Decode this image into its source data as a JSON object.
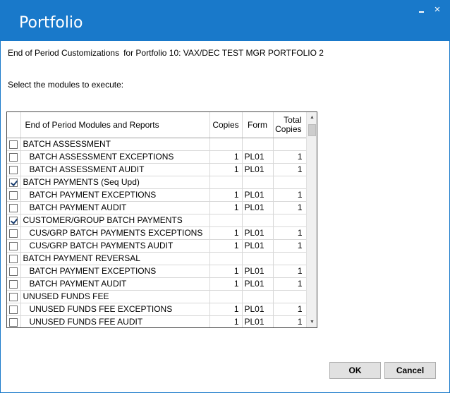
{
  "window": {
    "title": "Portfolio",
    "minimize_icon": "minimize-icon",
    "close_glyph": "×",
    "close_icon": "close-icon"
  },
  "header": {
    "heading": "End of Period Customizations",
    "portfolio_text": "for Portfolio 10: VAX/DEC TEST MGR PORTFOLIO 2",
    "prompt": "Select the modules to execute:"
  },
  "grid": {
    "columns": {
      "name": "End of Period Modules and Reports",
      "copies": "Copies",
      "form": "Form",
      "total_line1": "Total",
      "total_line2": "Copies"
    },
    "rows": [
      {
        "checked": false,
        "child": false,
        "name": "BATCH ASSESSMENT",
        "copies": "",
        "form": "",
        "total": ""
      },
      {
        "checked": false,
        "child": true,
        "name": "BATCH ASSESSMENT EXCEPTIONS",
        "copies": "1",
        "form": "PL01",
        "total": "1"
      },
      {
        "checked": false,
        "child": true,
        "name": "BATCH ASSESSMENT AUDIT",
        "copies": "1",
        "form": "PL01",
        "total": "1"
      },
      {
        "checked": true,
        "child": false,
        "name": "BATCH PAYMENTS (Seq Upd)",
        "copies": "",
        "form": "",
        "total": ""
      },
      {
        "checked": false,
        "child": true,
        "name": "BATCH PAYMENT EXCEPTIONS",
        "copies": "1",
        "form": "PL01",
        "total": "1"
      },
      {
        "checked": false,
        "child": true,
        "name": "BATCH PAYMENT AUDIT",
        "copies": "1",
        "form": "PL01",
        "total": "1"
      },
      {
        "checked": true,
        "child": false,
        "name": "CUSTOMER/GROUP BATCH PAYMENTS",
        "copies": "",
        "form": "",
        "total": ""
      },
      {
        "checked": false,
        "child": true,
        "name": "CUS/GRP BATCH PAYMENTS EXCEPTIONS",
        "copies": "1",
        "form": "PL01",
        "total": "1"
      },
      {
        "checked": false,
        "child": true,
        "name": "CUS/GRP BATCH PAYMENTS AUDIT",
        "copies": "1",
        "form": "PL01",
        "total": "1"
      },
      {
        "checked": false,
        "child": false,
        "name": "BATCH PAYMENT REVERSAL",
        "copies": "",
        "form": "",
        "total": ""
      },
      {
        "checked": false,
        "child": true,
        "name": "BATCH PAYMENT EXCEPTIONS",
        "copies": "1",
        "form": "PL01",
        "total": "1"
      },
      {
        "checked": false,
        "child": true,
        "name": "BATCH PAYMENT AUDIT",
        "copies": "1",
        "form": "PL01",
        "total": "1"
      },
      {
        "checked": false,
        "child": false,
        "name": "UNUSED FUNDS FEE",
        "copies": "",
        "form": "",
        "total": ""
      },
      {
        "checked": false,
        "child": true,
        "name": "UNUSED FUNDS FEE EXCEPTIONS",
        "copies": "1",
        "form": "PL01",
        "total": "1"
      },
      {
        "checked": false,
        "child": true,
        "name": "UNUSED FUNDS FEE AUDIT",
        "copies": "1",
        "form": "PL01",
        "total": "1"
      }
    ],
    "scrollbar": {
      "up_glyph": "▲",
      "down_glyph": "▼",
      "up_icon": "scroll-up-icon",
      "down_icon": "scroll-down-icon"
    }
  },
  "buttons": {
    "ok": "OK",
    "cancel": "Cancel"
  },
  "colors": {
    "titlebar": "#1979ca",
    "title_text": "#ffffff",
    "button_bg": "#e1e1e1"
  }
}
